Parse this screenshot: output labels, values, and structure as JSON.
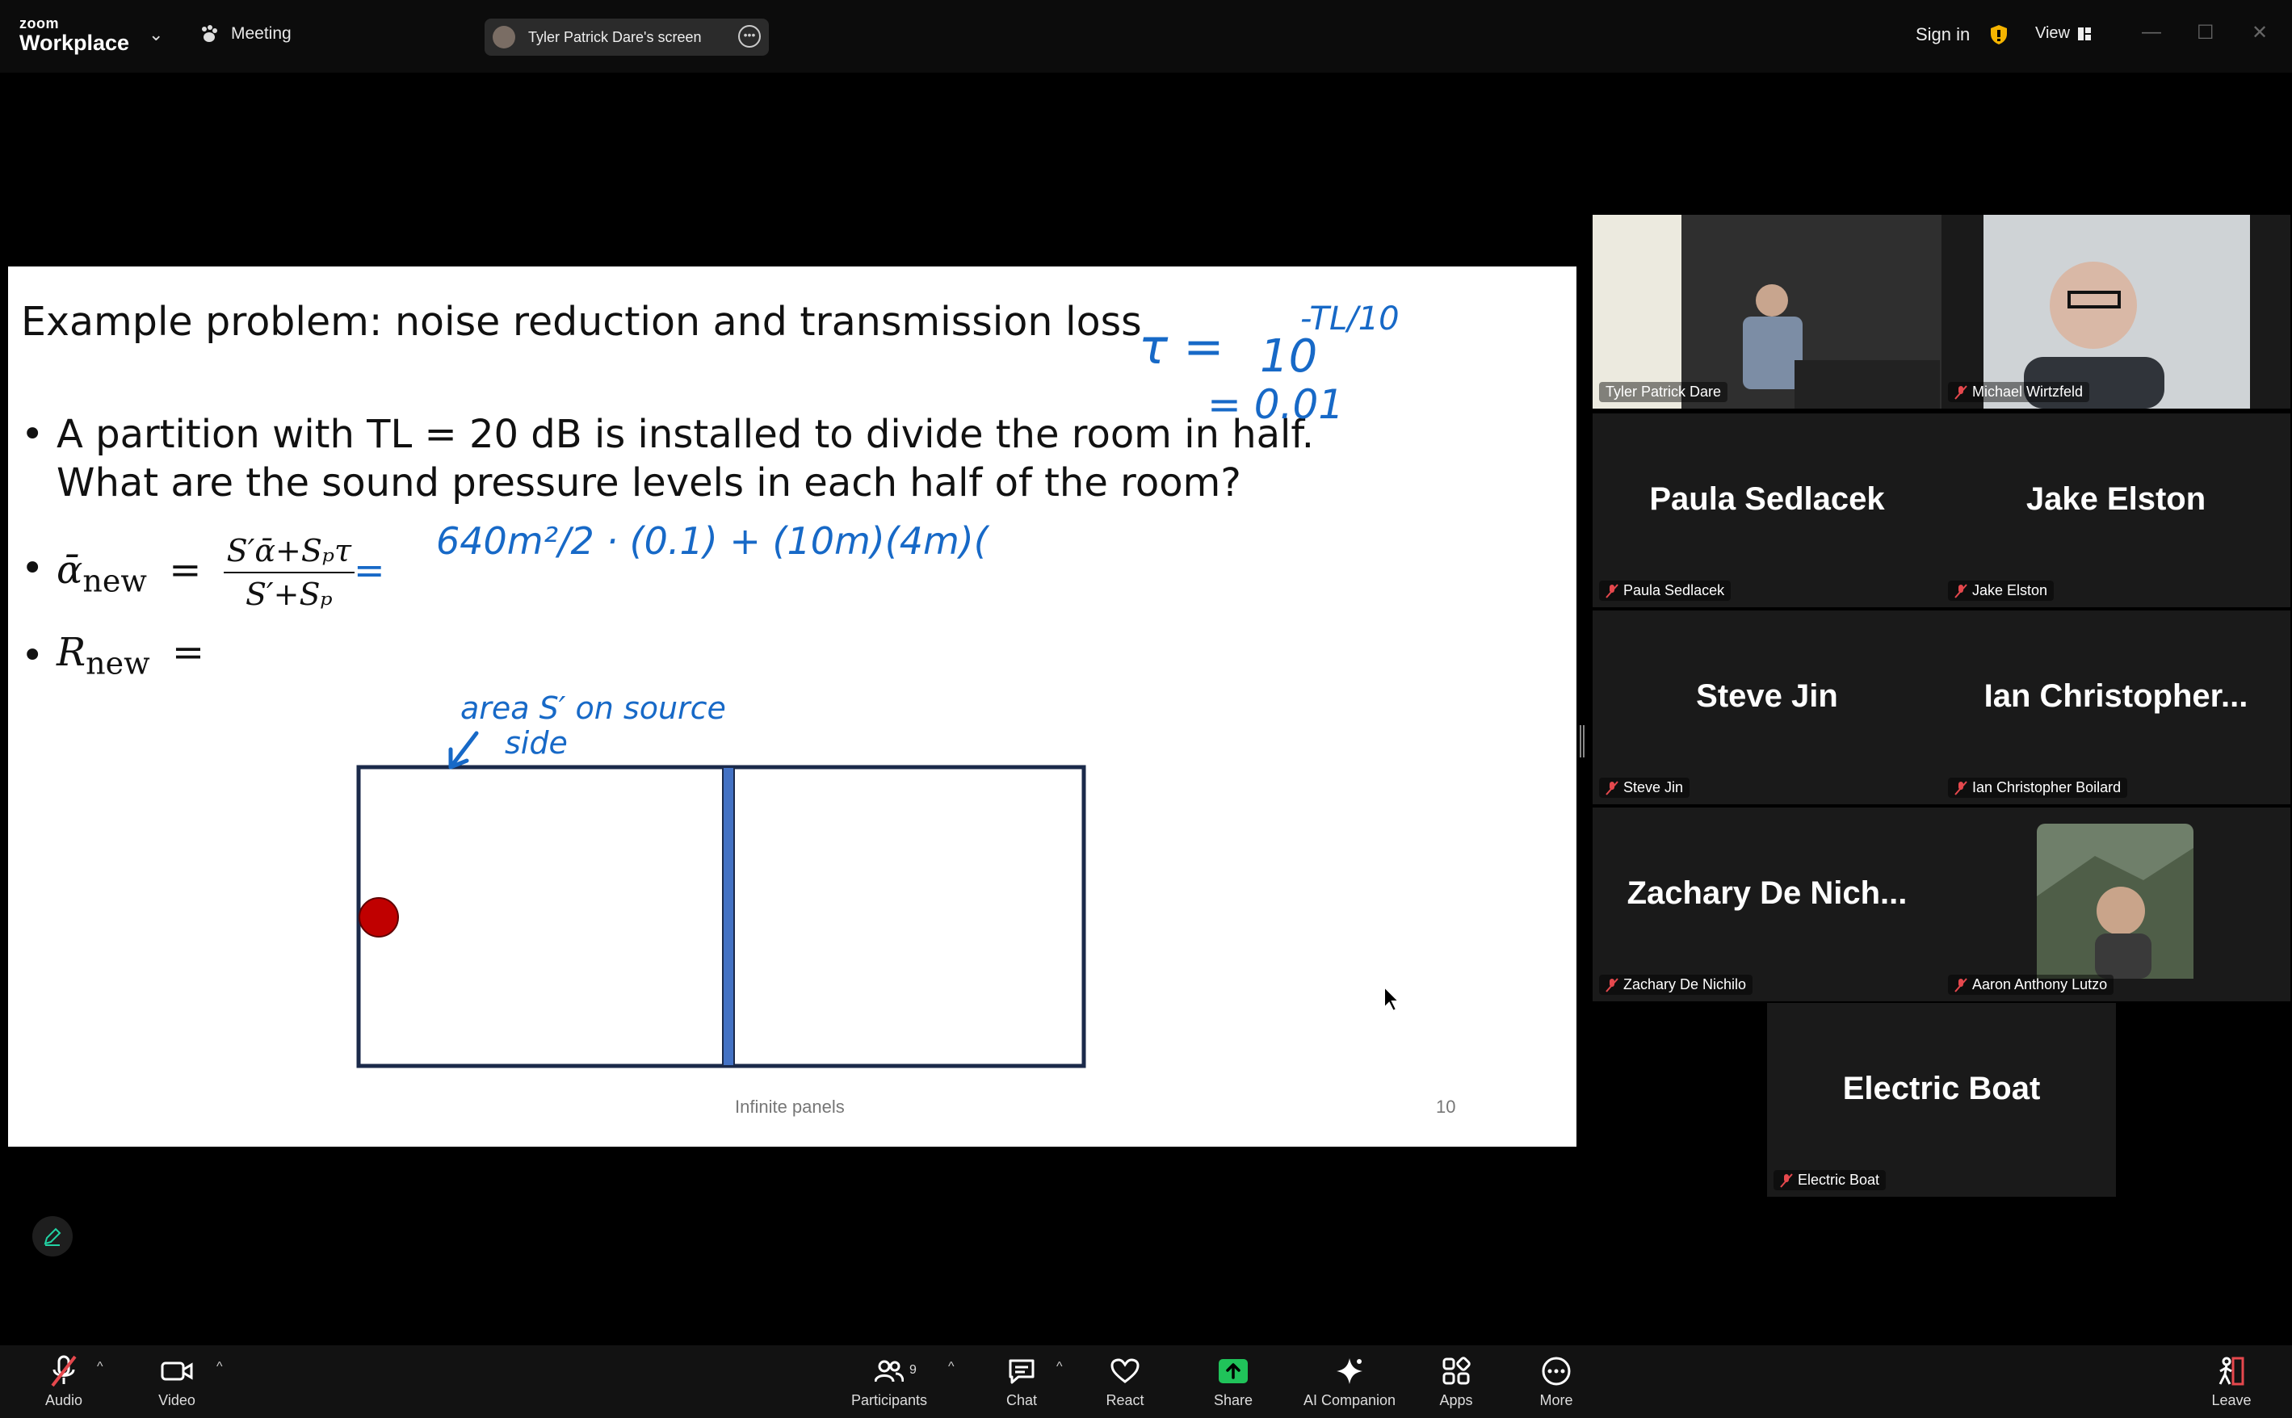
{
  "app": {
    "brand_small": "zoom",
    "brand_big": "Workplace",
    "meeting_label": "Meeting",
    "screen_share_label": "Tyler Patrick Dare's screen",
    "sign_in": "Sign in",
    "view": "View"
  },
  "slide": {
    "title": "Example problem: noise reduction and transmission loss",
    "bullet1_line1": "A partition with TL = 20 dB is installed to divide the room in half.",
    "bullet1_line2": "What are the sound pressure levels in each half of the room?",
    "bullet2_lhs": "ᾱ",
    "bullet2_sub": "new",
    "bullet2_eq": "=",
    "frac_num": "S′ᾱ+Sₚτ",
    "frac_den": "S′+Sₚ",
    "bullet3_lhs": "R",
    "bullet3_sub": "new",
    "bullet3_eq": "=",
    "footer": "Infinite panels",
    "page_number": "10"
  },
  "ink": {
    "tau_eq": "τ =",
    "ten": "10",
    "exponent": "-TL/10",
    "result": "= 0.01",
    "equals": "=",
    "expression": "640m²/2 · (0.1) + (10m)(4m)(",
    "note_line1": "area S′ on source",
    "note_line2": "side"
  },
  "participants": [
    {
      "display": "Tyler Patrick Dare",
      "label": "Tyler Patrick Dare",
      "video": true,
      "muted": false,
      "active": true
    },
    {
      "display": "Michael Wirtzfeld",
      "label": "Michael Wirtzfeld",
      "video": true,
      "muted": true
    },
    {
      "display": "Paula Sedlacek",
      "label": "Paula Sedlacek",
      "video": false,
      "muted": true
    },
    {
      "display": "Jake Elston",
      "label": "Jake Elston",
      "video": false,
      "muted": true
    },
    {
      "display": "Steve Jin",
      "label": "Steve Jin",
      "video": false,
      "muted": true
    },
    {
      "display": "Ian  Christopher...",
      "label": "Ian Christopher Boilard",
      "video": false,
      "muted": true
    },
    {
      "display": "Zachary  De  Nich...",
      "label": "Zachary De Nichilo",
      "video": false,
      "muted": true
    },
    {
      "display": "Aaron Anthony Lutzo",
      "label": "Aaron Anthony Lutzo",
      "video": true,
      "muted": true
    },
    {
      "display": "Electric Boat",
      "label": "Electric Boat",
      "video": false,
      "muted": true
    }
  ],
  "toolbar": {
    "audio": "Audio",
    "video": "Video",
    "participants": "Participants",
    "participants_count": "9",
    "chat": "Chat",
    "react": "React",
    "share": "Share",
    "ai_companion": "AI Companion",
    "apps": "Apps",
    "more": "More",
    "leave": "Leave"
  },
  "colors": {
    "accent_green": "#22d3a4",
    "share_green": "#20c35a",
    "ink_blue": "#1769c7",
    "muted_red": "#e5484d",
    "partition_blue": "#4472c4",
    "source_red": "#c00000"
  }
}
